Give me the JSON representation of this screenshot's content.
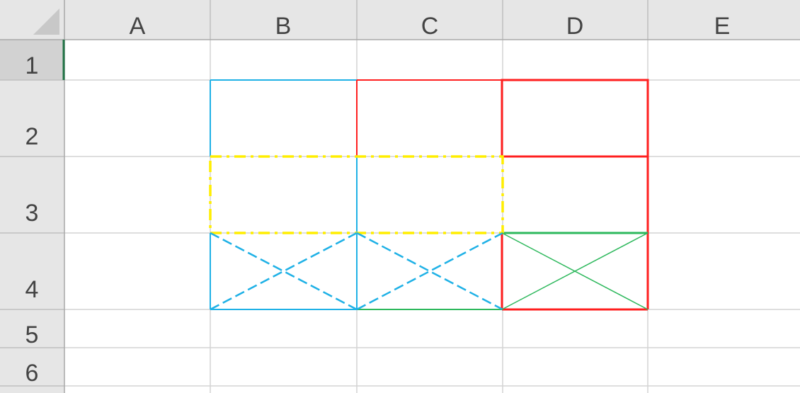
{
  "sheet": {
    "column_headers": [
      "A",
      "B",
      "C",
      "D",
      "E"
    ],
    "row_headers": [
      "1",
      "2",
      "3",
      "4",
      "5",
      "6"
    ],
    "selected_cell": "A1"
  },
  "colors": {
    "header_bg": "#e6e6e6",
    "header_selected_bg": "#d2d2d2",
    "header_text": "#444444",
    "gridline": "#d4d4d4",
    "header_line": "#bfbfbf",
    "select_accent": "#217346",
    "blue": "#1fb1e6",
    "red": "#ff1f1f",
    "yellow": "#ffee00",
    "green": "#2db85c"
  },
  "borders": [
    {
      "cell": "B2",
      "side": "top",
      "color": "blue",
      "style": "thin"
    },
    {
      "cell": "B2",
      "side": "left",
      "color": "blue",
      "style": "thin"
    },
    {
      "cell": "B3",
      "side": "right",
      "color": "blue",
      "style": "thin"
    },
    {
      "cell": "B4",
      "side": "left",
      "color": "blue",
      "style": "thin"
    },
    {
      "cell": "B4",
      "side": "bottom",
      "color": "blue",
      "style": "thin"
    },
    {
      "cell": "C4",
      "side": "left",
      "color": "blue",
      "style": "thin"
    },
    {
      "cell": "C4",
      "side": "bottom",
      "color": "green",
      "style": "thin"
    },
    {
      "cell": "C2",
      "side": "top",
      "color": "red",
      "style": "thin"
    },
    {
      "cell": "C2",
      "side": "left",
      "color": "red",
      "style": "thin"
    },
    {
      "cell": "D2",
      "side": "box",
      "color": "red",
      "style": "medium"
    },
    {
      "cell": "D3",
      "side": "right",
      "color": "red",
      "style": "medium"
    },
    {
      "cell": "D4",
      "side": "left",
      "color": "red",
      "style": "medium"
    },
    {
      "cell": "D4",
      "side": "right",
      "color": "red",
      "style": "medium"
    },
    {
      "cell": "D4",
      "side": "bottom",
      "color": "red",
      "style": "medium"
    },
    {
      "cell": "D4",
      "side": "top",
      "color": "green",
      "style": "medium"
    },
    {
      "cell": "B3:C3",
      "side": "box",
      "color": "yellow",
      "style": "dash-dot"
    },
    {
      "cell": "B4",
      "side": "diagonals",
      "color": "blue",
      "style": "dashed"
    },
    {
      "cell": "C4",
      "side": "diagonals",
      "color": "blue",
      "style": "dashed"
    },
    {
      "cell": "D4",
      "side": "diagonals",
      "color": "green",
      "style": "thin"
    }
  ]
}
